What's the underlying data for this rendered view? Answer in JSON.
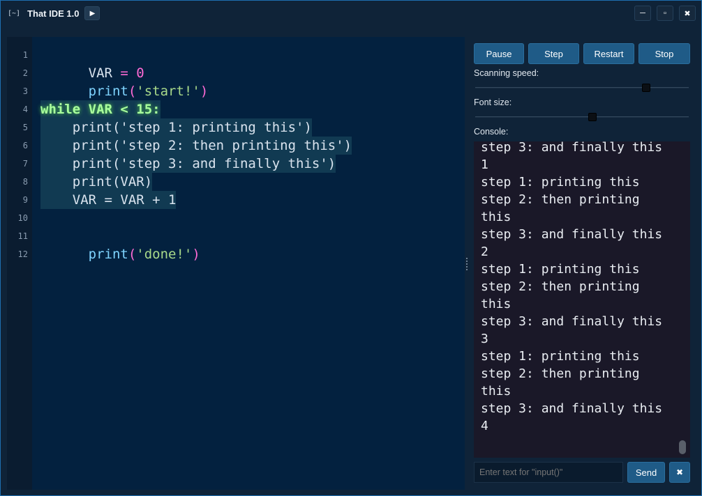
{
  "titlebar": {
    "logo": "[~]",
    "title": "That IDE 1.0",
    "run_icon": "▶",
    "minimize_icon": "─",
    "maximize_icon": "▫",
    "close_icon": "✖"
  },
  "editor": {
    "line_numbers": [
      "1",
      "2",
      "3",
      "4",
      "5",
      "6",
      "7",
      "8",
      "9",
      "10",
      "11",
      "12"
    ],
    "active_lines": [
      4,
      5,
      6,
      7,
      8,
      9
    ],
    "lines": {
      "l1_var": "VAR",
      "l1_eq": " = ",
      "l1_num": "0",
      "l2_func": "print",
      "l2_open": "(",
      "l2_str": "'start!'",
      "l2_close": ")",
      "l4": "while VAR < 15:",
      "l5": "    print('step 1: printing this')",
      "l6": "    print('step 2: then printing this')",
      "l7": "    print('step 3: and finally this')",
      "l8": "    print(VAR)",
      "l9": "    VAR = VAR + 1",
      "l11_func": "print",
      "l11_open": "(",
      "l11_str": "'done!'",
      "l11_close": ")"
    },
    "colors": {
      "background": "#03213f",
      "highlight": "#113a52",
      "number": "#ff6ad5",
      "string": "#a8d98a",
      "active": "#a9ff9d"
    }
  },
  "controls": {
    "pause": "Pause",
    "step": "Step",
    "restart": "Restart",
    "stop": "Stop"
  },
  "scanning_speed": {
    "label": "Scanning speed:",
    "value": 0.8
  },
  "font_size": {
    "label": "Font size:",
    "value": 0.55
  },
  "console": {
    "label": "Console:",
    "lines": [
      "step 3: and finally this",
      "1",
      "step 1: printing this",
      "step 2: then printing",
      "this",
      "step 3: and finally this",
      "2",
      "step 1: printing this",
      "step 2: then printing",
      "this",
      "step 3: and finally this",
      "3",
      "step 1: printing this",
      "step 2: then printing",
      "this",
      "step 3: and finally this",
      "4"
    ]
  },
  "input": {
    "placeholder": "Enter text for \"input()\"",
    "send": "Send",
    "clear_icon": "✖"
  }
}
